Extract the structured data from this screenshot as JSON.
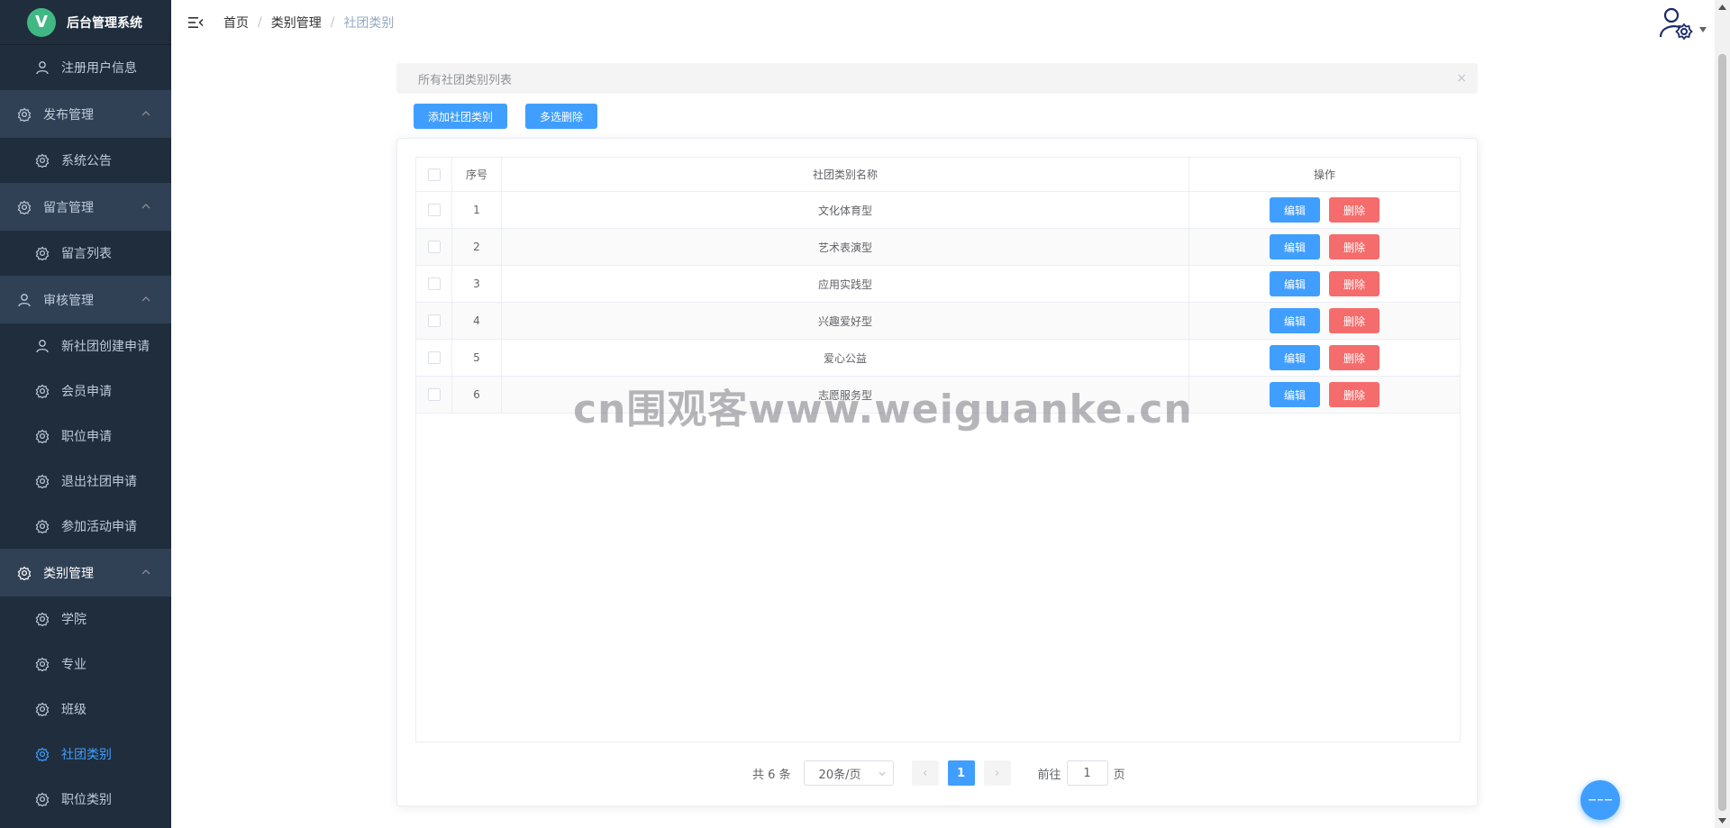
{
  "app": {
    "title": "后台管理系统",
    "logo_letter": "V"
  },
  "sidebar": {
    "top_item": {
      "label": "注册用户信息",
      "icon": "user-icon"
    },
    "groups": [
      {
        "label": "发布管理",
        "icon": "gear-icon",
        "items": [
          {
            "label": "系统公告",
            "icon": "gear-icon"
          }
        ]
      },
      {
        "label": "留言管理",
        "icon": "gear-icon",
        "items": [
          {
            "label": "留言列表",
            "icon": "gear-icon"
          }
        ]
      },
      {
        "label": "审核管理",
        "icon": "user-icon",
        "items": [
          {
            "label": "新社团创建申请",
            "icon": "user-icon"
          },
          {
            "label": "会员申请",
            "icon": "gear-icon"
          },
          {
            "label": "职位申请",
            "icon": "gear-icon"
          },
          {
            "label": "退出社团申请",
            "icon": "gear-icon"
          },
          {
            "label": "参加活动申请",
            "icon": "gear-icon"
          }
        ]
      },
      {
        "label": "类别管理",
        "icon": "gear-icon",
        "items": [
          {
            "label": "学院",
            "icon": "gear-icon"
          },
          {
            "label": "专业",
            "icon": "gear-icon"
          },
          {
            "label": "班级",
            "icon": "gear-icon"
          },
          {
            "label": "社团类别",
            "icon": "gear-icon",
            "active": true
          },
          {
            "label": "职位类别",
            "icon": "gear-icon"
          }
        ]
      }
    ]
  },
  "header": {
    "breadcrumb": [
      "首页",
      "类别管理",
      "社团类别"
    ],
    "separator": "/"
  },
  "alert": {
    "text": "所有社团类别列表",
    "close": "×"
  },
  "toolbar": {
    "add_label": "添加社团类别",
    "batch_delete_label": "多选删除"
  },
  "table": {
    "columns": [
      "序号",
      "社团类别名称",
      "操作"
    ],
    "edit_label": "编辑",
    "delete_label": "删除",
    "rows": [
      {
        "index": "1",
        "name": "文化体育型"
      },
      {
        "index": "2",
        "name": "艺术表演型"
      },
      {
        "index": "3",
        "name": "应用实践型"
      },
      {
        "index": "4",
        "name": "兴趣爱好型"
      },
      {
        "index": "5",
        "name": "爱心公益"
      },
      {
        "index": "6",
        "name": "志愿服务型"
      }
    ]
  },
  "pagination": {
    "total_text": "共 6 条",
    "page_size": "20条/页",
    "prev": "‹",
    "next": "›",
    "current_page": "1",
    "goto_prefix": "前往",
    "goto_value": "1",
    "goto_suffix": "页"
  },
  "watermark": "cn围观客www.weiguanke.cn",
  "colors": {
    "primary": "#409eff",
    "danger": "#f56c6c",
    "sidebar_bg": "#1f2d3d",
    "sidebar_group_bg": "#304156",
    "logo": "#41b883"
  }
}
